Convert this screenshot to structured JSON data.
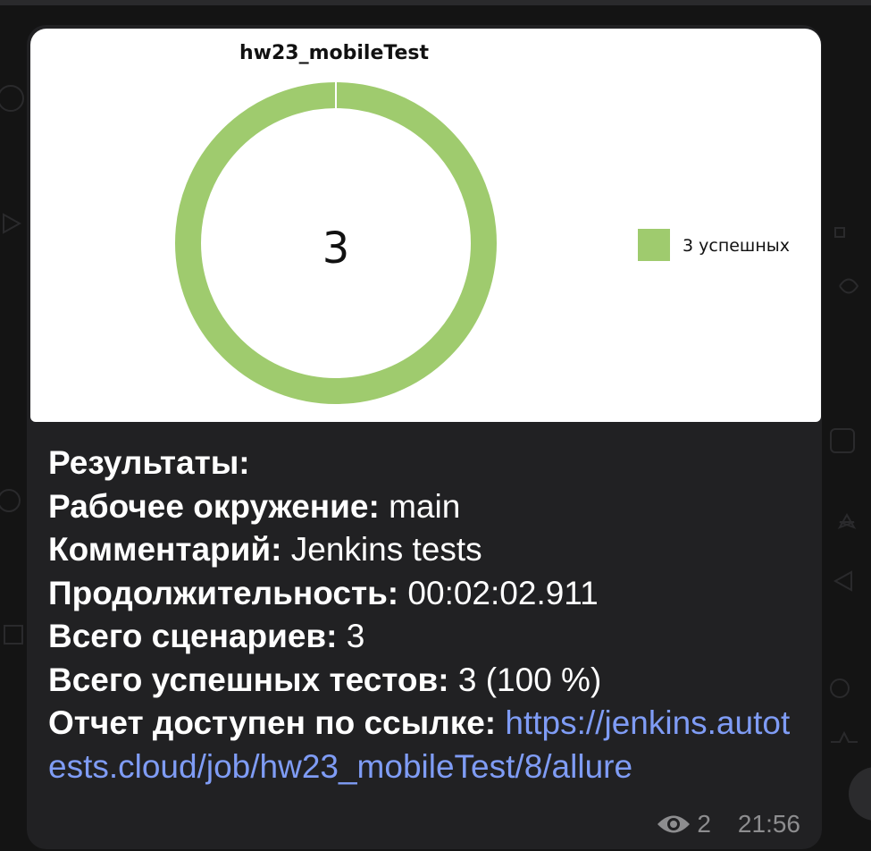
{
  "chart_data": {
    "type": "pie",
    "title": "hw23_mobileTest",
    "center_label": "3",
    "categories": [
      "3 успешных"
    ],
    "values": [
      3
    ],
    "colors": [
      "#9fcb6e"
    ],
    "legend_position": "right"
  },
  "message": {
    "results_label": "Результаты:",
    "env_label": "Рабочее окружение:",
    "env_value": " main",
    "comment_label": "Комментарий:",
    "comment_value": " Jenkins tests",
    "duration_label": "Продолжительность:",
    "duration_value": " 00:02:02.911",
    "scenarios_label": "Всего сценариев:",
    "scenarios_value": " 3",
    "passed_label": "Всего успешных тестов:",
    "passed_value": " 3 (100 %)",
    "report_label": "Отчет доступен по ссылке:",
    "report_link": "https://jenkins.autotests.cloud/job/hw23_mobileTest/8/allure"
  },
  "footer": {
    "views": "2",
    "time": "21:56",
    "views_icon": "eye-icon"
  }
}
